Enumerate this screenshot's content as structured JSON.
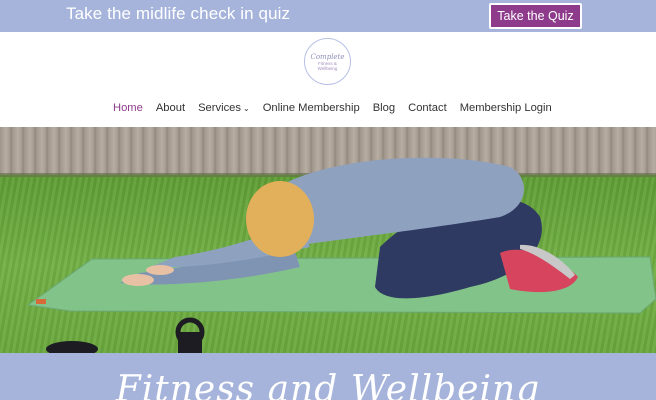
{
  "topbar": {
    "promo_text": "Take the midlife check in quiz",
    "quiz_button": "Take the Quiz"
  },
  "logo": {
    "line1": "Complete",
    "line2": "Fitness &",
    "line3": "Wellbeing"
  },
  "nav": {
    "items": [
      {
        "label": "Home",
        "active": true
      },
      {
        "label": "About"
      },
      {
        "label": "Services",
        "has_dropdown": true
      },
      {
        "label": "Online Membership"
      },
      {
        "label": "Blog"
      },
      {
        "label": "Contact"
      },
      {
        "label": "Membership Login"
      }
    ],
    "dropdown_icon": "chevron-down-icon"
  },
  "hero": {
    "image_desc_icon": "hero-photo"
  },
  "banner": {
    "title": "Fitness and Wellbeing"
  },
  "colors": {
    "bar_bg": "#a6b4dc",
    "accent_purple": "#8e3b8c",
    "nav_text": "#333333"
  }
}
